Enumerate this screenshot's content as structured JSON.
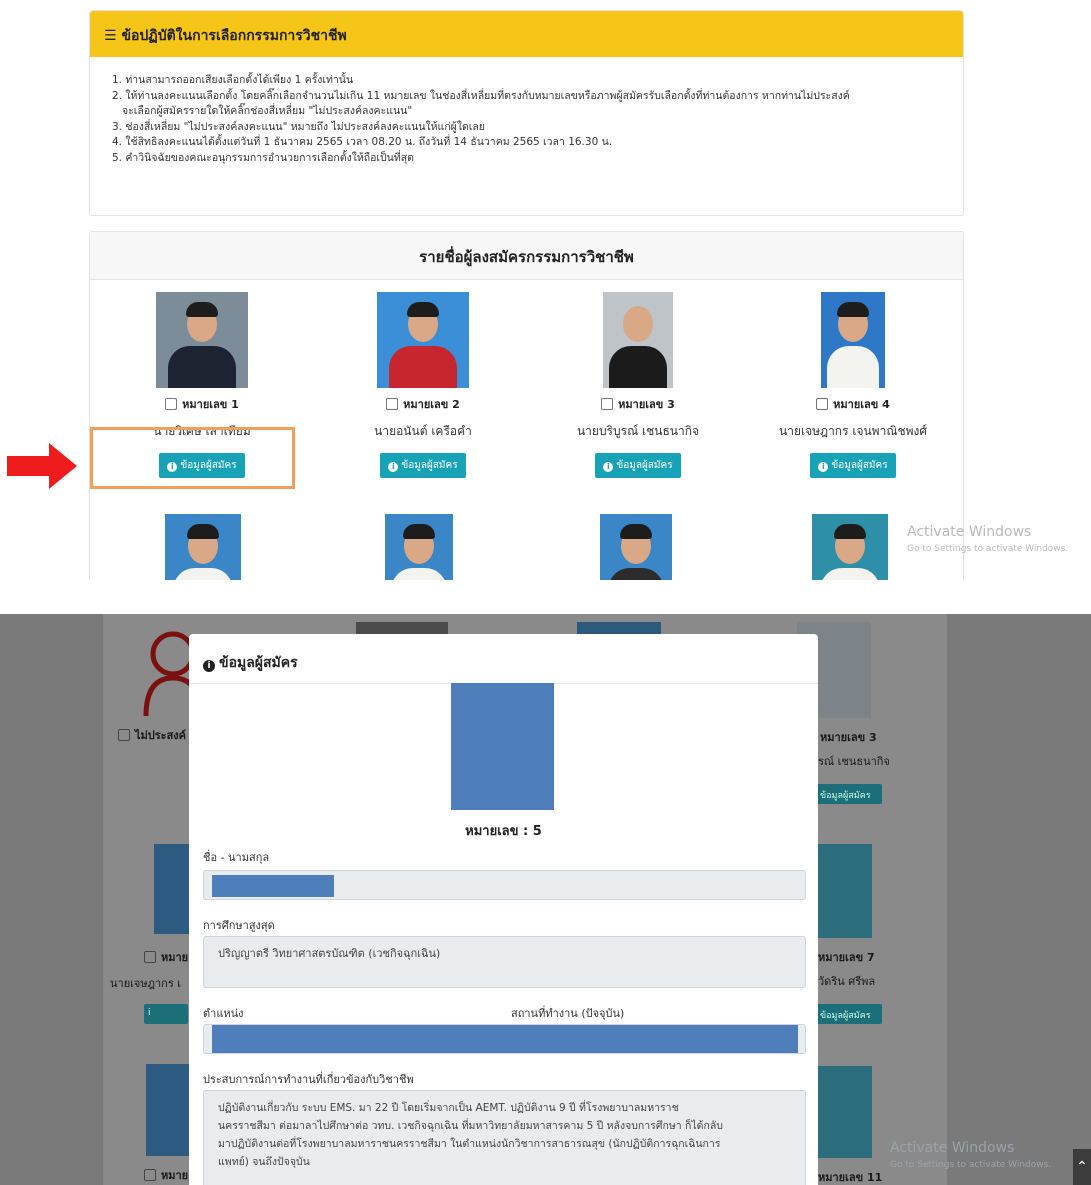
{
  "rules": {
    "title": "ข้อปฏิบัติในการเลือกกรรมการวิชาชีพ",
    "items": [
      "1. ท่านสามารถออกเสียงเลือกตั้งได้เพียง 1 ครั้งเท่านั้น",
      "2. ให้ท่านลงคะแนนเลือกตั้ง โดยคลิ๊กเลือกจำนวนไม่เกิน 11 หมายเลข ในช่องสี่เหลี่ยมที่ตรงกับหมายเลขหรือภาพผู้สมัครรับเลือกตั้งที่ท่านต้องการ หากท่านไม่ประสงค์",
      "จะเลือกผู้สมัครรายใดให้คลิ๊กช่องสี่เหลี่ยม \"ไม่ประสงค์ลงคะแนน\"",
      "3. ช่องสี่เหลี่ยม \"ไม่ประสงค์ลงคะแนน\" หมายถึง ไม่ประสงค์ลงคะแนนให้แก่ผู้ใดเลย",
      "4. ใช้สิทธิลงคะแนนได้ตั้งแต่วันที่ 1 ธันวาคม 2565 เวลา 08.20 น. ถึงวันที่ 14 ธันวาคม 2565 เวลา 16.30 น.",
      "5. คำวินิจฉัยของคณะอนุกรรมการอำนวยการเลือกตั้งให้ถือเป็นที่สุด"
    ]
  },
  "candidates_section": {
    "title": "รายชื่อผู้ลงสมัครกรรมการวิชาชีพ",
    "info_button": "ข้อมูลผู้สมัคร",
    "candidates": [
      {
        "number": "หมายเลข 1",
        "name": "นายวิเศษ เสาเทียม",
        "color": "#1d2330"
      },
      {
        "number": "หมายเลข 2",
        "name": "นายอนันต์ เครือคำ",
        "color": "#c7262f"
      },
      {
        "number": "หมายเลข 3",
        "name": "นายบริบูรณ์ เชนธนากิจ",
        "color": "#1b1b1b"
      },
      {
        "number": "หมายเลข 4",
        "name": "นายเจษฎากร เจนพาณิชพงศ์",
        "color": "#f3f3f0"
      }
    ]
  },
  "watermark": {
    "title": "Activate Windows",
    "subtitle": "Go to Settings to activate Windows."
  },
  "background": {
    "no_vote": "ไม่ประสงค์",
    "num3": "หมายเลข 3",
    "name3": "รณ์ เชนธนากิจ",
    "btn": "ข้อมูลผู้สมัคร",
    "num_left": "หมาย",
    "name_left": "นายเจษฎากร เ",
    "num7": "หมายเลข 7",
    "name7": "วัดริน ศรีพล",
    "num11": "หมายเลข 11"
  },
  "modal": {
    "title": "ข้อมูลผู้สมัคร",
    "number": "หมายเลข : 5",
    "name_label": "ชื่อ - นามสกุล",
    "education_label": "การศึกษาสูงสุด",
    "education_value": "ปริญญาตรี วิทยาศาสตรบัณฑิต (เวชกิจฉุกเฉิน)",
    "position_label": "ตำแหน่ง",
    "workplace_label": "สถานที่ทำงาน (ปัจจุบัน)",
    "experience_label": "ประสบการณ์การทำงานที่เกี่ยวข้องกับวิชาชีพ",
    "experience_lines": [
      "ปฏิบัติงานเกี่ยวกับ ระบบ EMS. มา  22  ปี  โดยเริ่มจากเป็น  AEMT. ปฏิบัติงาน  9  ปี ที่โรงพยาบาลมหาราช",
      "นครราชสีมา  ต่อมาลาไปศึกษาต่อ  วทบ. เวชกิจฉุกเฉิน  ที่มหาวิทยาลัยมหาสารคาม  5  ปี  หลังจบการศึกษา  ก็ได้กลับ",
      "มาปฏิบัติงานต่อที่โรงพยาบาลมหาราชนครราชสีมา  ในตำแหน่งนักวิชาการสาธารณสุข  (นักปฏิบัติการฉุกเฉินการ",
      "แพทย์)  จนถึงปัจจุบัน"
    ]
  }
}
